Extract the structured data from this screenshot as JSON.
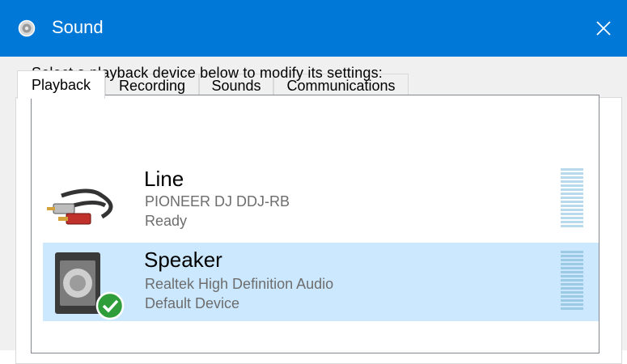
{
  "window": {
    "title": "Sound",
    "close_glyph": "✕",
    "accent_color": "#0078d7"
  },
  "tabs": [
    {
      "label": "Playback",
      "active": true
    },
    {
      "label": "Recording",
      "active": false
    },
    {
      "label": "Sounds",
      "active": false
    },
    {
      "label": "Communications",
      "active": false
    }
  ],
  "instruction": "Select a playback device below to modify its settings:",
  "devices": [
    {
      "name": "Line",
      "description": "PIONEER DJ DDJ-RB",
      "status": "Ready",
      "icon": "rca-cable-icon",
      "selected": false
    },
    {
      "name": "Speaker",
      "description": "Realtek High Definition Audio",
      "status": "Default Device",
      "icon": "speaker-icon",
      "badge_icon": "default-check-icon",
      "selected": true
    }
  ]
}
